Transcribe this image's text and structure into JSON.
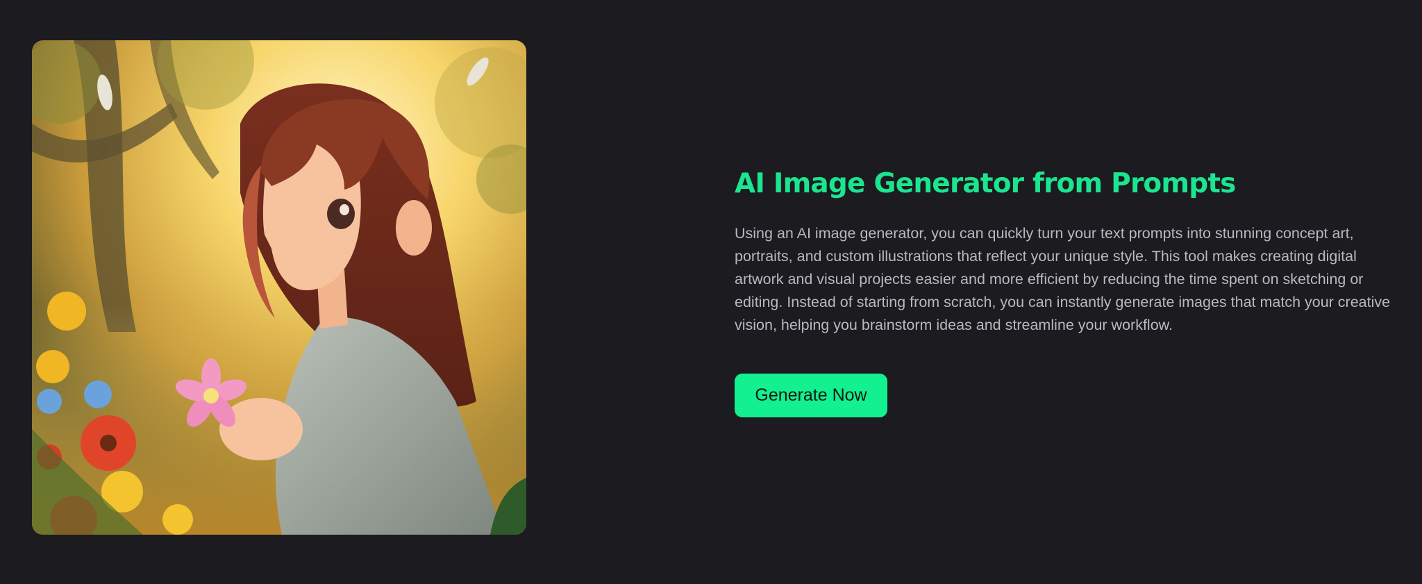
{
  "hero": {
    "image_subject": "anime girl holding a pink flower in a sunlit forest",
    "title": "AI Image Generator from Prompts",
    "description": "Using an AI image generator, you can quickly turn your text prompts into stunning concept art, portraits, and custom illustrations that reflect your unique style. This tool makes creating digital artwork and visual projects easier and more efficient by reducing the time spent on sketching or editing. Instead of starting from scratch, you can instantly generate images that match your creative vision, helping you brainstorm ideas and streamline your workflow.",
    "cta_label": "Generate Now"
  },
  "colors": {
    "background": "#1b1b20",
    "accent": "#12f08f",
    "title": "#1be58f",
    "body_text": "#b8b9bf"
  }
}
